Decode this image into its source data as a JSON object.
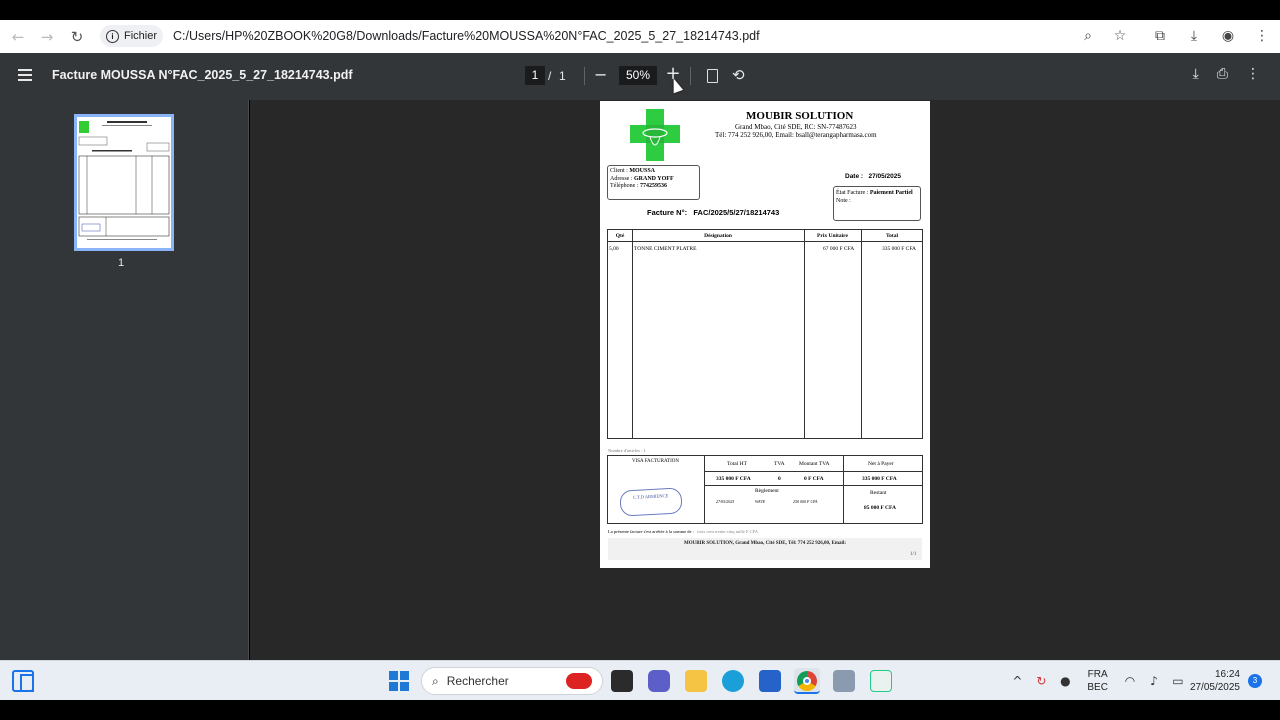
{
  "browser": {
    "back_icon": "←",
    "forward_icon": "→",
    "reload_icon": "↻",
    "scheme_label": "Fichier",
    "url": "C:/Users/HP%20ZBOOK%20G8/Downloads/Facture%20MOUSSA%20N°FAC_2025_5_27_18214743.pdf",
    "zoom_icon": "⌕",
    "star_icon": "☆",
    "extensions_icon": "⧉",
    "download_icon": "⤓",
    "profile_icon": "◉",
    "menu_icon": "⋮"
  },
  "pdf_toolbar": {
    "title": "Facture MOUSSA N°FAC_2025_5_27_18214743.pdf",
    "page_current": "1",
    "page_sep": "/",
    "page_total": "1",
    "zoom_out": "−",
    "zoom_value": "50%",
    "zoom_in": "+",
    "rotate_icon": "⟲",
    "download_icon": "⤓",
    "print_icon": "⎙",
    "more_icon": "⋮"
  },
  "thumbnail": {
    "page_label": "1"
  },
  "invoice": {
    "company": "MOUBIR SOLUTION",
    "address": "Grand Mbao, Cité SDE,  RC: SN-77487623",
    "contact": "Tél: 774 252 926,00, Email: bsall@terangapharmasa.com",
    "client_label": "Client :",
    "client": "MOUSSA",
    "address_label": "Adresse :",
    "client_address": "GRAND YOFF",
    "phone_label": "Téléphone :",
    "phone": "774259536",
    "date_label": "Date :",
    "date": "27/05/2025",
    "etat_label": "État Facture :",
    "etat": "Paiement Partiel",
    "note_label": "Note :",
    "facture_label": "Facture N°:",
    "facture_no": "FAC/2025/5/27/18214743",
    "columns": [
      "Qté",
      "Désignation",
      "Prix Unitaire",
      "Total"
    ],
    "row": {
      "qty": "5,00",
      "designation": "TONNE CIMENT PLATRE",
      "unit_price": "67 000  F CFA",
      "total": "335 000  F CFA"
    },
    "nb_articles": "Nombre d'articles :    1",
    "visa": "VISA FACTURATION",
    "total_ht_label": "Total HT",
    "tva_label": "TVA",
    "montant_tva_label": "Montant TVA",
    "net_label": "Net à Payer",
    "total_ht": "335 000  F CFA",
    "tva": "0",
    "montant_tva": "0  F CFA",
    "net": "335 000  F CFA",
    "reglement_label": "Règlement",
    "reg_date": "27/05/2025",
    "reg_mode": "WAVE",
    "reg_amount": "250 000  F CFA",
    "restant_label": "Restant",
    "restant": "85 000  F CFA",
    "arrete": "La présente facture s'est arrêtée à la somme de :",
    "arrete_value": "trois cent trente-cinq mille F CFA",
    "footer": "MOUBIR SOLUTION, Grand Mbao, Cité SDE, Tél: 774 252 926,00, Email:",
    "page_num": "1/1",
    "stamp": "C.T.D ARMIENCE"
  },
  "taskbar": {
    "search_placeholder": "Rechercher",
    "lang_top": "FRA",
    "lang_bottom": "BEC",
    "time": "16:24",
    "date": "27/05/2025",
    "notif_count": "3",
    "chevron_icon": "^",
    "wifi_icon": "◠",
    "volume_icon": "♪",
    "battery_icon": "▭",
    "mic_icon": "●"
  }
}
